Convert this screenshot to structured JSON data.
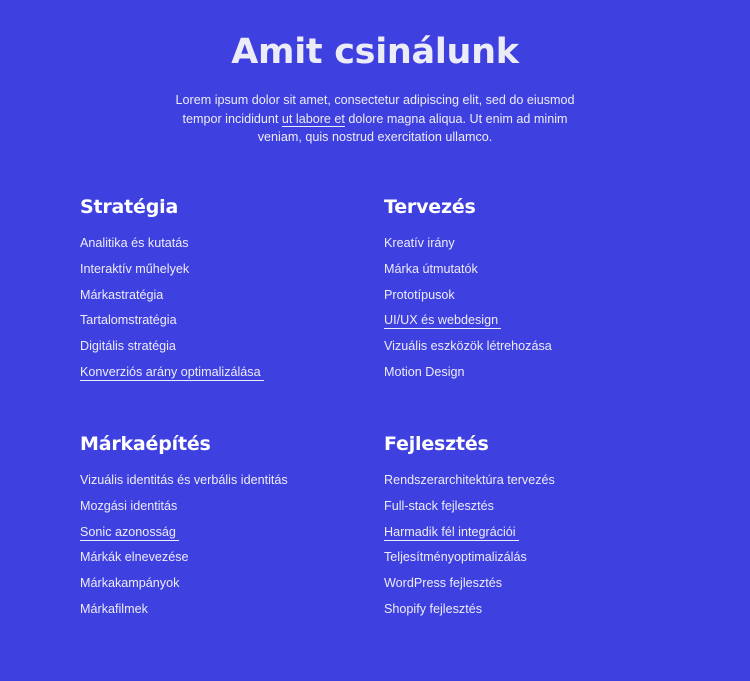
{
  "header": {
    "title": "Amit csinálunk",
    "intro_before": "Lorem ipsum dolor sit amet, consectetur adipiscing elit, sed do eiusmod tempor incididunt ",
    "intro_link": "ut labore et",
    "intro_after": " dolore magna aliqua. Ut enim ad minim veniam, quis nostrud exercitation ullamco."
  },
  "colors": {
    "background": "#3f40e0",
    "text": "#ececf8",
    "heading": "#ffffff"
  },
  "sections": [
    {
      "title": "Stratégia",
      "items": [
        {
          "label": "Analitika és kutatás",
          "link": false
        },
        {
          "label": "Interaktív műhelyek",
          "link": false
        },
        {
          "label": "Márkastratégia",
          "link": false
        },
        {
          "label": "Tartalomstratégia",
          "link": false
        },
        {
          "label": "Digitális stratégia",
          "link": false
        },
        {
          "label": "Konverziós arány optimalizálása",
          "link": true
        }
      ]
    },
    {
      "title": "Tervezés",
      "items": [
        {
          "label": "Kreatív irány",
          "link": false
        },
        {
          "label": "Márka útmutatók",
          "link": false
        },
        {
          "label": "Prototípusok",
          "link": false
        },
        {
          "label": "UI/UX és webdesign",
          "link": true
        },
        {
          "label": "Vizuális eszközök létrehozása",
          "link": false
        },
        {
          "label": "Motion Design",
          "link": false
        }
      ]
    },
    {
      "title": "Márkaépítés",
      "items": [
        {
          "label": "Vizuális identitás és verbális identitás",
          "link": false
        },
        {
          "label": "Mozgási identitás",
          "link": false
        },
        {
          "label": "Sonic azonosság",
          "link": true
        },
        {
          "label": "Márkák elnevezése",
          "link": false
        },
        {
          "label": "Márkakampányok",
          "link": false
        },
        {
          "label": "Márkafilmek",
          "link": false
        }
      ]
    },
    {
      "title": "Fejlesztés",
      "items": [
        {
          "label": "Rendszerarchitektúra tervezés",
          "link": false
        },
        {
          "label": "Full-stack fejlesztés",
          "link": false
        },
        {
          "label": "Harmadik fél integrációi",
          "link": true
        },
        {
          "label": "Teljesítményoptimalizálás",
          "link": false
        },
        {
          "label": "WordPress fejlesztés",
          "link": false
        },
        {
          "label": "Shopify fejlesztés",
          "link": false
        }
      ]
    }
  ]
}
